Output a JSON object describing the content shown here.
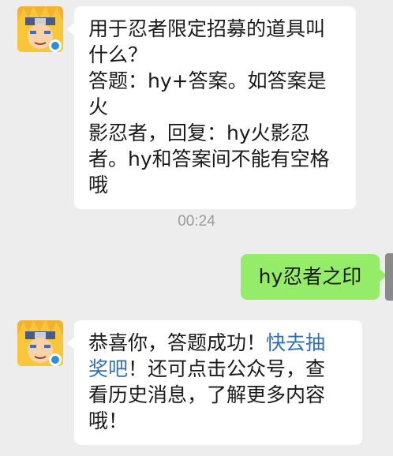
{
  "messages": [
    {
      "sender": "bot",
      "lines": [
        "用于忍者限定招募的道具叫",
        "什么？",
        "答题：hy+答案。如答案是火",
        "影忍者，回复：hy火影忍",
        "者。hy和答案间不能有空格",
        "哦"
      ]
    },
    {
      "sender": "user",
      "text": "hy忍者之印"
    },
    {
      "sender": "bot",
      "line1_before": "恭喜你，答题成功！",
      "line1_link": "快去抽",
      "line2_link": "奖吧",
      "line2_after": "！还可点击公众号，查",
      "line3": "看历史消息，了解更多内容",
      "line4": "哦！"
    }
  ],
  "timestamp": "00:24",
  "colors": {
    "background": "#ededed",
    "user_bubble": "#95ec69",
    "bot_bubble": "#ffffff",
    "link": "#2f6fb5"
  },
  "icons": {
    "bot_avatar": "ninja-avatar-icon",
    "badge": "tencent-game-badge-icon"
  }
}
